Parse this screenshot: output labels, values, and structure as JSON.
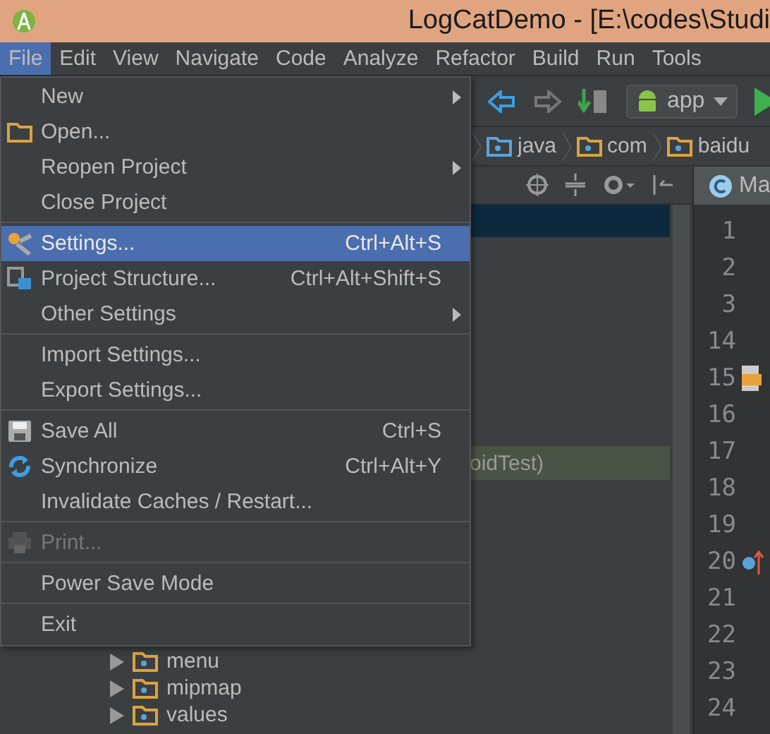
{
  "title_bar": {
    "title": "LogCatDemo - [E:\\codes\\Studi"
  },
  "menu_bar": [
    {
      "label": "File",
      "selected": true
    },
    {
      "label": "Edit",
      "selected": false
    },
    {
      "label": "View",
      "selected": false
    },
    {
      "label": "Navigate",
      "selected": false
    },
    {
      "label": "Code",
      "selected": false
    },
    {
      "label": "Analyze",
      "selected": false
    },
    {
      "label": "Refactor",
      "selected": false
    },
    {
      "label": "Build",
      "selected": false
    },
    {
      "label": "Run",
      "selected": false
    },
    {
      "label": "Tools",
      "selected": false
    }
  ],
  "toolbar": {
    "run_config": "app"
  },
  "breadcrumbs": [
    "java",
    "com",
    "baidu"
  ],
  "project_tree": {
    "highlight_label": "oidTest)",
    "folders": [
      "menu",
      "mipmap",
      "values"
    ]
  },
  "editor_tab": {
    "label": "Ma"
  },
  "line_numbers": [
    {
      "label": "1",
      "kind": "plain"
    },
    {
      "label": "2",
      "kind": "plain"
    },
    {
      "label": "3",
      "kind": "plain"
    },
    {
      "label": "14",
      "kind": "plain"
    },
    {
      "label": "15",
      "kind": "layout-marker"
    },
    {
      "label": "16",
      "kind": "plain"
    },
    {
      "label": "17",
      "kind": "plain"
    },
    {
      "label": "18",
      "kind": "plain"
    },
    {
      "label": "19",
      "kind": "plain"
    },
    {
      "label": "20",
      "kind": "override-marker"
    },
    {
      "label": "21",
      "kind": "plain"
    },
    {
      "label": "22",
      "kind": "plain"
    },
    {
      "label": "23",
      "kind": "plain"
    },
    {
      "label": "24",
      "kind": "plain"
    }
  ],
  "file_menu": {
    "items": [
      {
        "kind": "item",
        "label": "New",
        "submenu": true,
        "selected": false,
        "disabled": false
      },
      {
        "kind": "item",
        "label": "Open...",
        "submenu": false,
        "selected": false,
        "disabled": false
      },
      {
        "kind": "item",
        "label": "Reopen Project",
        "submenu": true,
        "selected": false,
        "disabled": false
      },
      {
        "kind": "item",
        "label": "Close Project",
        "submenu": false,
        "selected": false,
        "disabled": false
      },
      {
        "kind": "separator"
      },
      {
        "kind": "item",
        "label": "Settings...",
        "shortcut": "Ctrl+Alt+S",
        "submenu": false,
        "selected": true,
        "disabled": false
      },
      {
        "kind": "item",
        "label": "Project Structure...",
        "shortcut": "Ctrl+Alt+Shift+S",
        "submenu": false,
        "selected": false,
        "disabled": false
      },
      {
        "kind": "item",
        "label": "Other Settings",
        "submenu": true,
        "selected": false,
        "disabled": false
      },
      {
        "kind": "separator"
      },
      {
        "kind": "item",
        "label": "Import Settings...",
        "submenu": false,
        "selected": false,
        "disabled": false
      },
      {
        "kind": "item",
        "label": "Export Settings...",
        "submenu": false,
        "selected": false,
        "disabled": false
      },
      {
        "kind": "separator"
      },
      {
        "kind": "item",
        "label": "Save All",
        "shortcut": "Ctrl+S",
        "submenu": false,
        "selected": false,
        "disabled": false
      },
      {
        "kind": "item",
        "label": "Synchronize",
        "shortcut": "Ctrl+Alt+Y",
        "submenu": false,
        "selected": false,
        "disabled": false
      },
      {
        "kind": "item",
        "label": "Invalidate Caches / Restart...",
        "submenu": false,
        "selected": false,
        "disabled": false
      },
      {
        "kind": "separator"
      },
      {
        "kind": "item",
        "label": "Print...",
        "submenu": false,
        "selected": false,
        "disabled": true
      },
      {
        "kind": "separator"
      },
      {
        "kind": "item",
        "label": "Power Save Mode",
        "submenu": false,
        "selected": false,
        "disabled": false
      },
      {
        "kind": "separator"
      },
      {
        "kind": "item",
        "label": "Exit",
        "submenu": false,
        "selected": false,
        "disabled": false
      }
    ]
  }
}
